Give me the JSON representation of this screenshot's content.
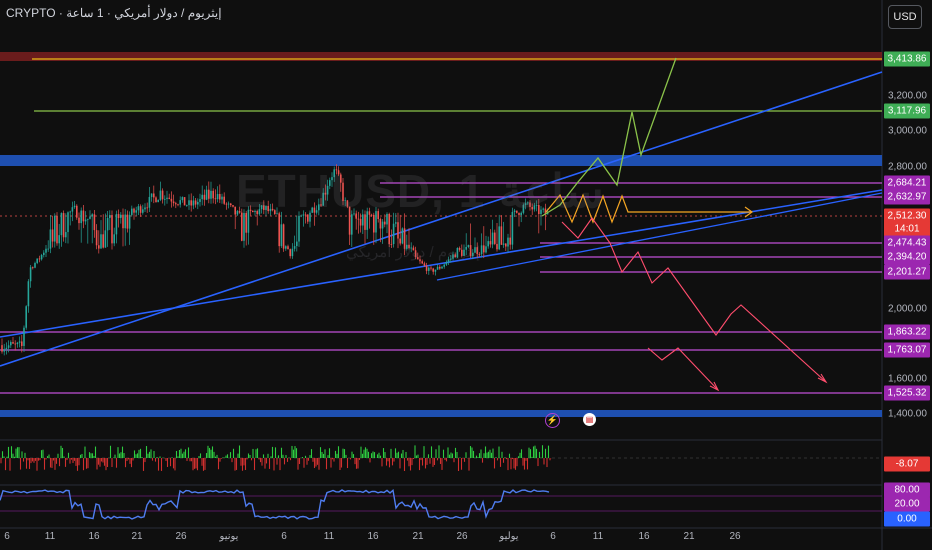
{
  "header": {
    "title": "CRYPTO · إيثريوم / دولار أمريكي · 1 ساعة",
    "currency_button": "USD"
  },
  "watermark": {
    "symbol": "ETHUSD, 1 ساعة",
    "subtitle": "إيثريوم / دولار أمريكي"
  },
  "price_axis": {
    "ticks": [
      "3,200.00",
      "3,000.00",
      "2,800.00",
      "2,000.00",
      "1,600.00",
      "1,400.00"
    ],
    "badges": [
      {
        "value": "3,413.86",
        "color": "#3fae56"
      },
      {
        "value": "3,117.96",
        "color": "#3fae56"
      },
      {
        "value": "2,684.21",
        "color": "#9c27b0"
      },
      {
        "value": "2,632.97",
        "color": "#9c27b0"
      },
      {
        "value": "2,512.30",
        "color": "#e53935"
      },
      {
        "value": "14:01",
        "color": "#e53935"
      },
      {
        "value": "2,474.43",
        "color": "#9c27b0"
      },
      {
        "value": "2,394.20",
        "color": "#9c27b0"
      },
      {
        "value": "2,201.27",
        "color": "#9c27b0"
      },
      {
        "value": "1,863.22",
        "color": "#9c27b0"
      },
      {
        "value": "1,763.07",
        "color": "#9c27b0"
      },
      {
        "value": "1,525.32",
        "color": "#9c27b0"
      }
    ],
    "oscillator_value": "-8.07",
    "rsi_upper": "80.00",
    "rsi_mid": "20.00",
    "rsi_value": "0.00"
  },
  "time_axis": {
    "labels": [
      "6",
      "11",
      "16",
      "21",
      "26",
      "يونيو",
      "6",
      "11",
      "16",
      "21",
      "26",
      "يوليو",
      "6",
      "11",
      "16",
      "21",
      "26"
    ]
  },
  "colors": {
    "bull": "#26a69a",
    "bear": "#ef5350",
    "trendline": "#2962ff",
    "zone": "#1e4fb0",
    "level": "#c04fd6",
    "target": "#8bc34a",
    "bearish_path": "#ff4d6d"
  },
  "icons": {
    "lightning": "lightning-icon",
    "flag": "us-flag-icon"
  }
}
